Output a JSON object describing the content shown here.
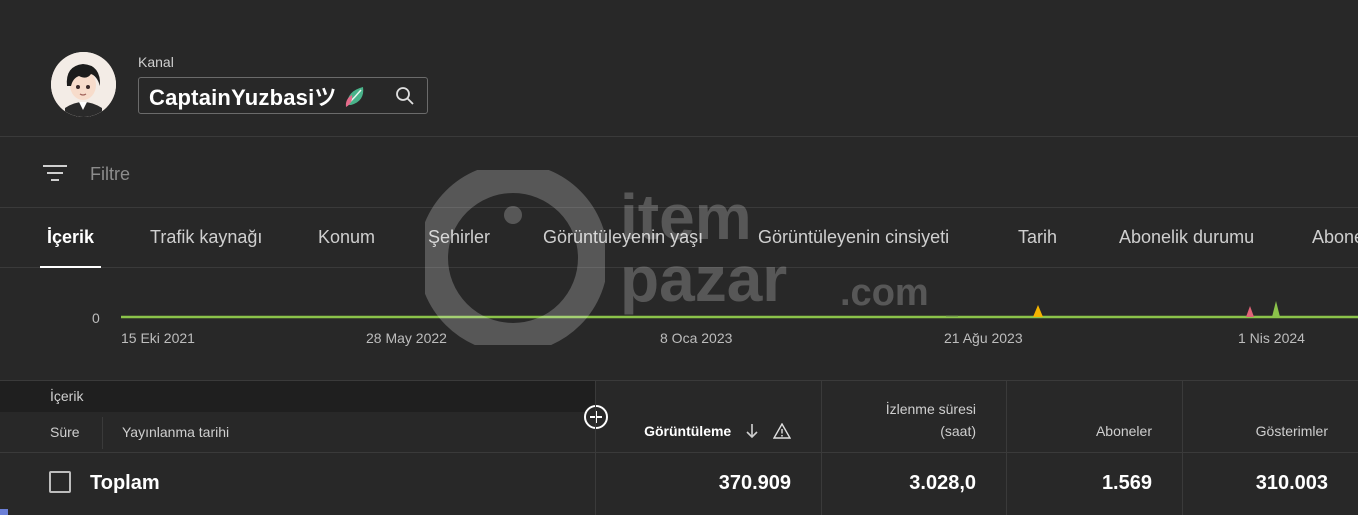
{
  "header": {
    "channel_label": "Kanal",
    "channel_name": "CaptainYuzbasiツ"
  },
  "filter": {
    "placeholder": "Filtre"
  },
  "tabs": [
    {
      "label": "İçerik",
      "active": true
    },
    {
      "label": "Trafik kaynağı"
    },
    {
      "label": "Konum"
    },
    {
      "label": "Şehirler"
    },
    {
      "label": "Görüntüleyenin yaşı"
    },
    {
      "label": "Görüntüleyenin cinsiyeti"
    },
    {
      "label": "Tarih"
    },
    {
      "label": "Abonelik durumu"
    },
    {
      "label": "Abone"
    }
  ],
  "watermark": {
    "line1": "item",
    "line2": "pazar",
    "suffix": ".com"
  },
  "chart_data": {
    "type": "area",
    "y_tick": "0",
    "x_ticks": [
      "15 Eki 2021",
      "28 May 2022",
      "8 Oca 2023",
      "21 Ağu 2023",
      "1 Nis 2024"
    ],
    "baseline_color": "#8bc34a",
    "spikes": [
      {
        "near": "21 Ağu 2023",
        "color": "#f4b400"
      },
      {
        "near": "1 Nis 2024",
        "color": "#e06377"
      },
      {
        "near": "1 Nis 2024",
        "color": "#8bc34a"
      }
    ]
  },
  "table": {
    "content_header": "İçerik",
    "col_duration": "Süre",
    "col_published": "Yayınlanma tarihi",
    "metrics": [
      {
        "label": "Görüntüleme",
        "sorted": true
      },
      {
        "label_line1": "İzlenme süresi",
        "label_line2": "(saat)"
      },
      {
        "label": "Aboneler"
      },
      {
        "label": "Gösterimler"
      }
    ],
    "total": {
      "label": "Toplam",
      "views": "370.909",
      "watch_time": "3.028,0",
      "subscribers": "1.569",
      "impressions": "310.003"
    }
  }
}
